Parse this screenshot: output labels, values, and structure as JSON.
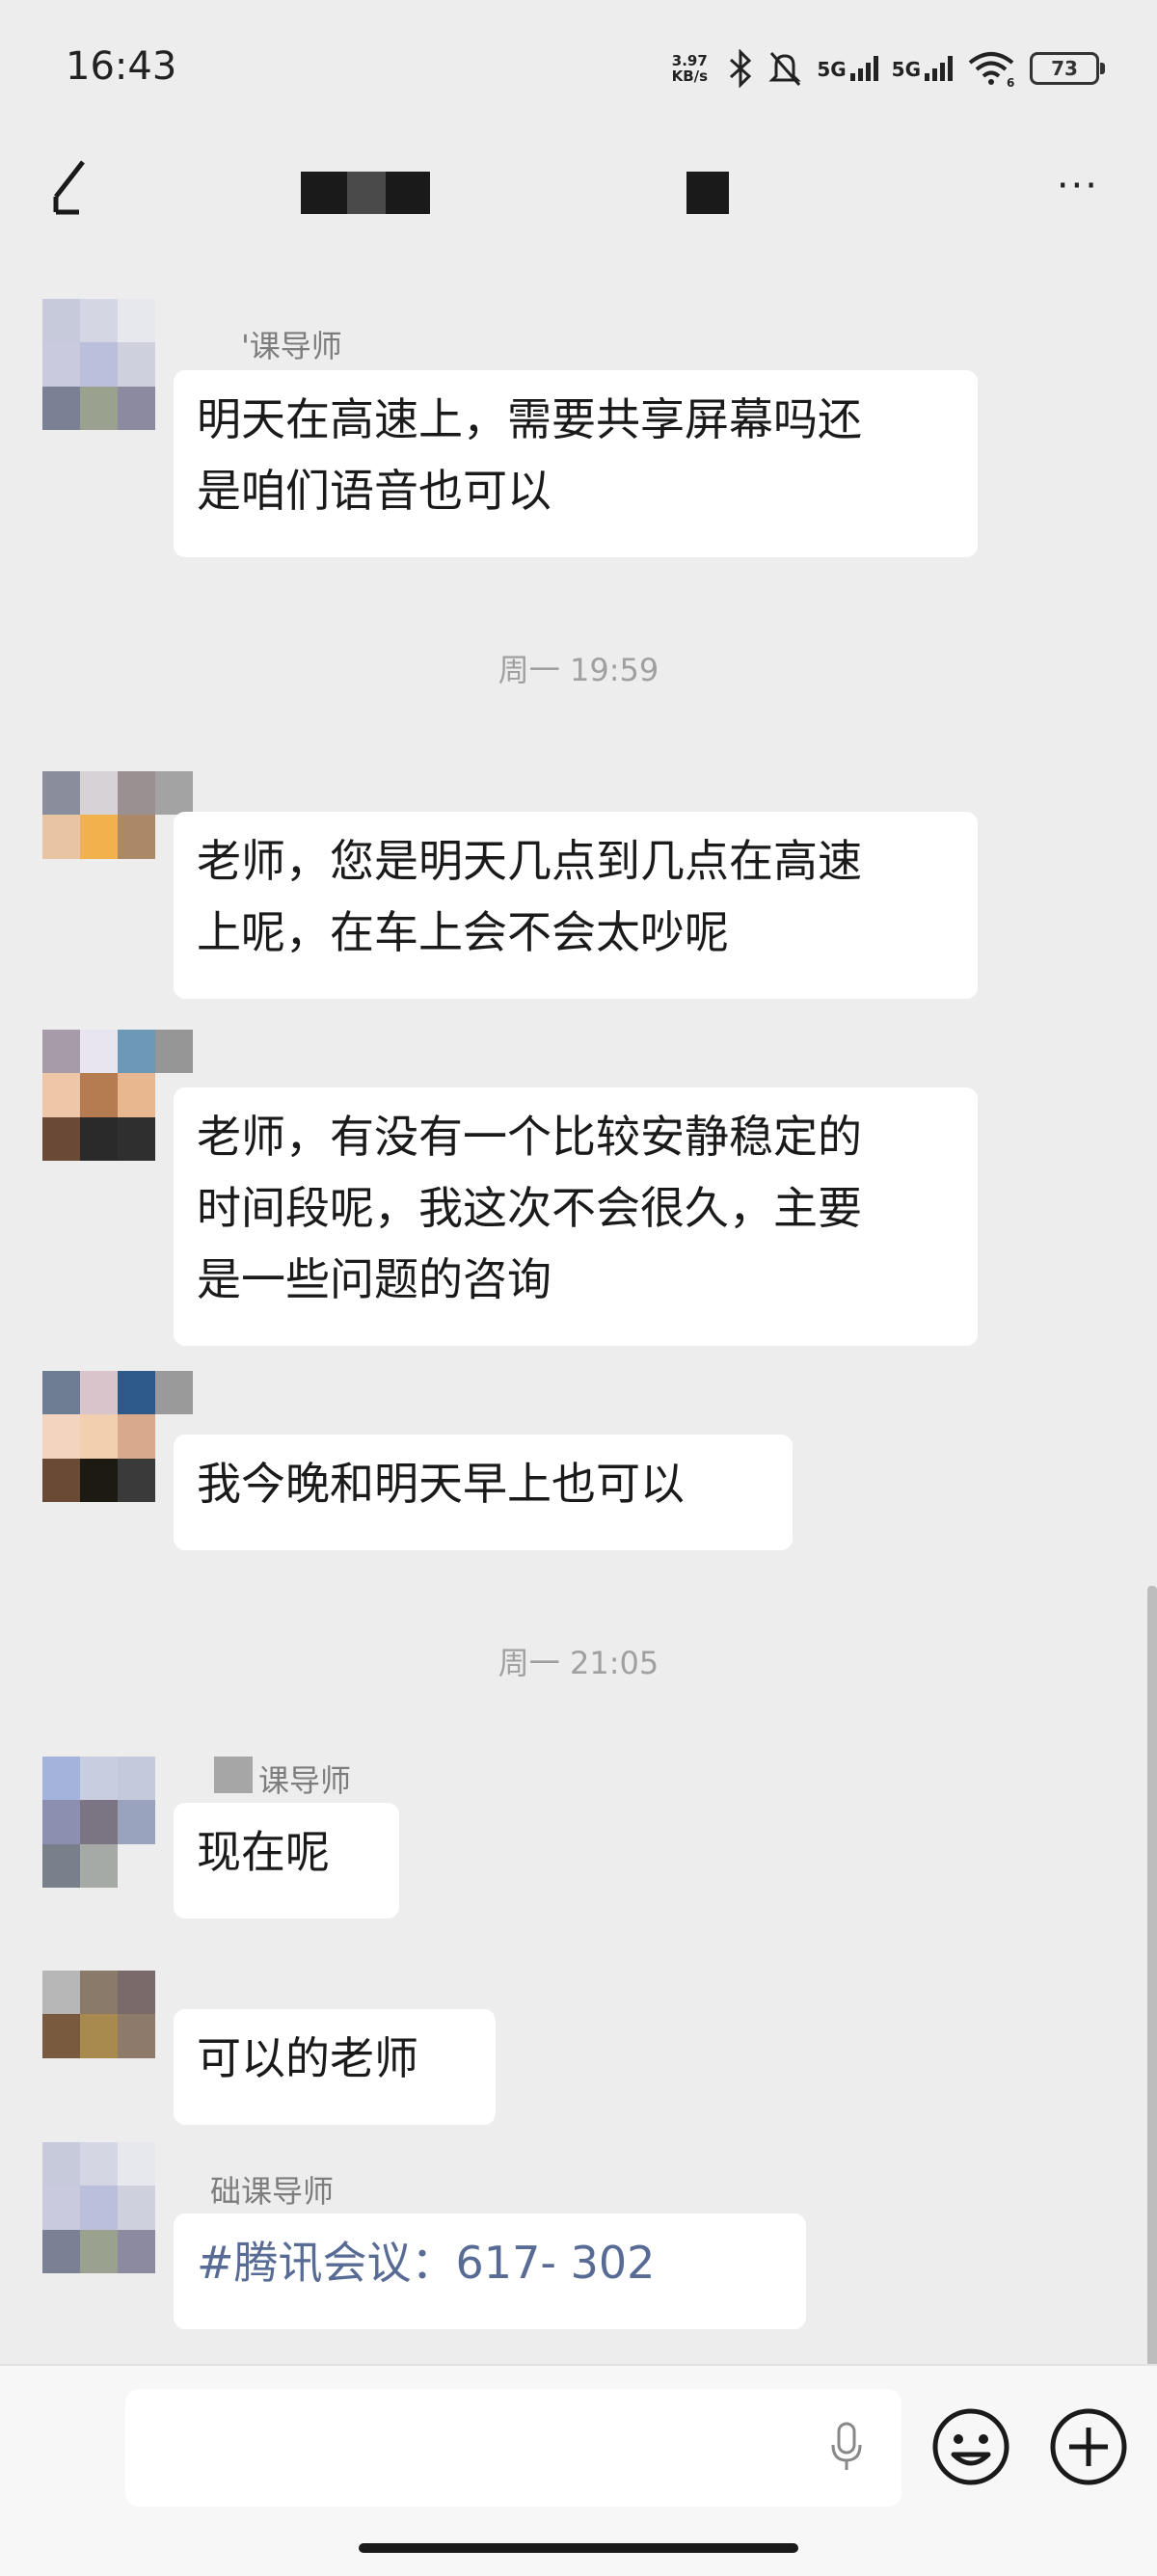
{
  "status_bar": {
    "time": "16:43",
    "net_speed_top": "3.97",
    "net_speed_bottom": "KB/s",
    "sim1": "5G",
    "sim2": "5G",
    "wifi_badge": "6",
    "battery": "73",
    "icons": [
      "bluetooth-icon",
      "mute-bell-icon",
      "signal-icon",
      "wifi-icon",
      "battery-icon"
    ]
  },
  "nav": {
    "back_icon": "back-arrow-icon",
    "more_label": "···"
  },
  "messages": [
    {
      "sender": "'课导师",
      "text": [
        "明天在高速上，需要共享屏幕吗还",
        "是咱们语音也可以"
      ]
    },
    {
      "timestamp": "周一 19:59"
    },
    {
      "text": [
        "老师，您是明天几点到几点在高速",
        "上呢，在车上会不会太吵呢"
      ]
    },
    {
      "text": [
        "老师，有没有一个比较安静稳定的",
        "时间段呢，我这次不会很久，主要",
        "是一些问题的咨询"
      ]
    },
    {
      "text": [
        "我今晚和明天早上也可以"
      ]
    },
    {
      "timestamp": "周一 21:05"
    },
    {
      "sender": "课导师",
      "text": [
        "现在呢"
      ]
    },
    {
      "text": [
        "可以的老师"
      ]
    },
    {
      "sender": "础课导师",
      "text": [
        "#腾讯会议：617-     302"
      ]
    }
  ],
  "input_bar": {
    "voice_icon": "microphone-icon",
    "emoji_icon": "smiley-icon",
    "plus_icon": "plus-circle-icon"
  },
  "colors": {
    "background": "#ededed",
    "bubble": "#ffffff",
    "link": "#576b95",
    "timestamp": "#a0a0a0"
  }
}
